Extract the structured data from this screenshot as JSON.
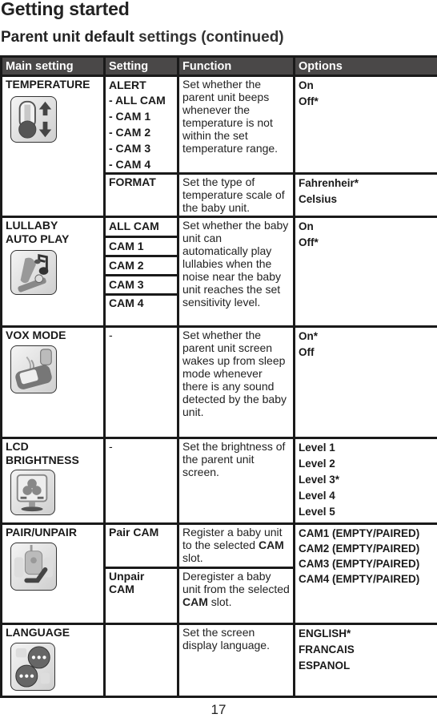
{
  "header": {
    "title": "Getting started",
    "subtitle_bold": "Parent unit default",
    "subtitle_rest": " settings (continued)"
  },
  "table": {
    "columns": [
      "Main setting",
      "Setting",
      "Function",
      "Options"
    ],
    "temperature": {
      "main": "TEMPERATURE",
      "icon": "thermometer-icon",
      "alert": {
        "setting": "ALERT",
        "cams": [
          "- ALL CAM",
          "- CAM 1",
          "- CAM 2",
          "- CAM 3",
          "- CAM 4"
        ],
        "function": "Set whether the parent unit beeps whenever the temperature is not within the set temperature range.",
        "options": [
          "On",
          "Off*"
        ]
      },
      "format": {
        "setting": "FORMAT",
        "function": "Set the type of temperature scale of the baby unit.",
        "options": [
          "Fahrenheir*",
          "Celsius"
        ]
      }
    },
    "lullaby": {
      "main_line1": "LULLABY",
      "main_line2": "AUTO PLAY",
      "icon": "music-note-icon",
      "settings": [
        "ALL CAM",
        "CAM 1",
        "CAM 2",
        "CAM 3",
        "CAM 4"
      ],
      "function": "Set whether the baby unit can automatically play lullabies when the noise near the baby unit reaches the set sensitivity level.",
      "options": [
        "On",
        "Off*"
      ]
    },
    "vox": {
      "main": "VOX MODE",
      "icon": "vox-monitor-icon",
      "setting": "-",
      "function": "Set whether the parent unit screen wakes up from sleep mode whenever there is any sound detected by the baby unit.",
      "options": [
        "On*",
        "Off"
      ]
    },
    "lcd": {
      "main_line1": "LCD",
      "main_line2": "BRIGHTNESS",
      "icon": "brightness-screen-icon",
      "setting": "-",
      "function": "Set the brightness of the parent unit screen.",
      "options": [
        "Level 1",
        "Level 2",
        "Level 3*",
        "Level 4",
        "Level 5"
      ]
    },
    "pair": {
      "main": "PAIR/UNPAIR",
      "icon": "pair-camera-icon",
      "pair_setting": "Pair CAM",
      "pair_function_pre": "Register a baby unit to the selected ",
      "pair_function_bold": "CAM",
      "pair_function_post": " slot.",
      "unpair_setting_line1": "Unpair",
      "unpair_setting_line2": "CAM",
      "unpair_function_pre": "Deregister a baby unit from the selected ",
      "unpair_function_bold": "CAM",
      "unpair_function_post": " slot.",
      "options": [
        "CAM1 (EMPTY/PAIRED)",
        "CAM2 (EMPTY/PAIRED)",
        "CAM3 (EMPTY/PAIRED)",
        "CAM4 (EMPTY/PAIRED)"
      ]
    },
    "language": {
      "main": "LANGUAGE",
      "icon": "speech-bubbles-icon",
      "setting": "",
      "function": "Set the screen display language.",
      "options": [
        "ENGLISH*",
        "FRANCAIS",
        "ESPANOL"
      ]
    }
  },
  "footer": {
    "page_number": "17"
  }
}
